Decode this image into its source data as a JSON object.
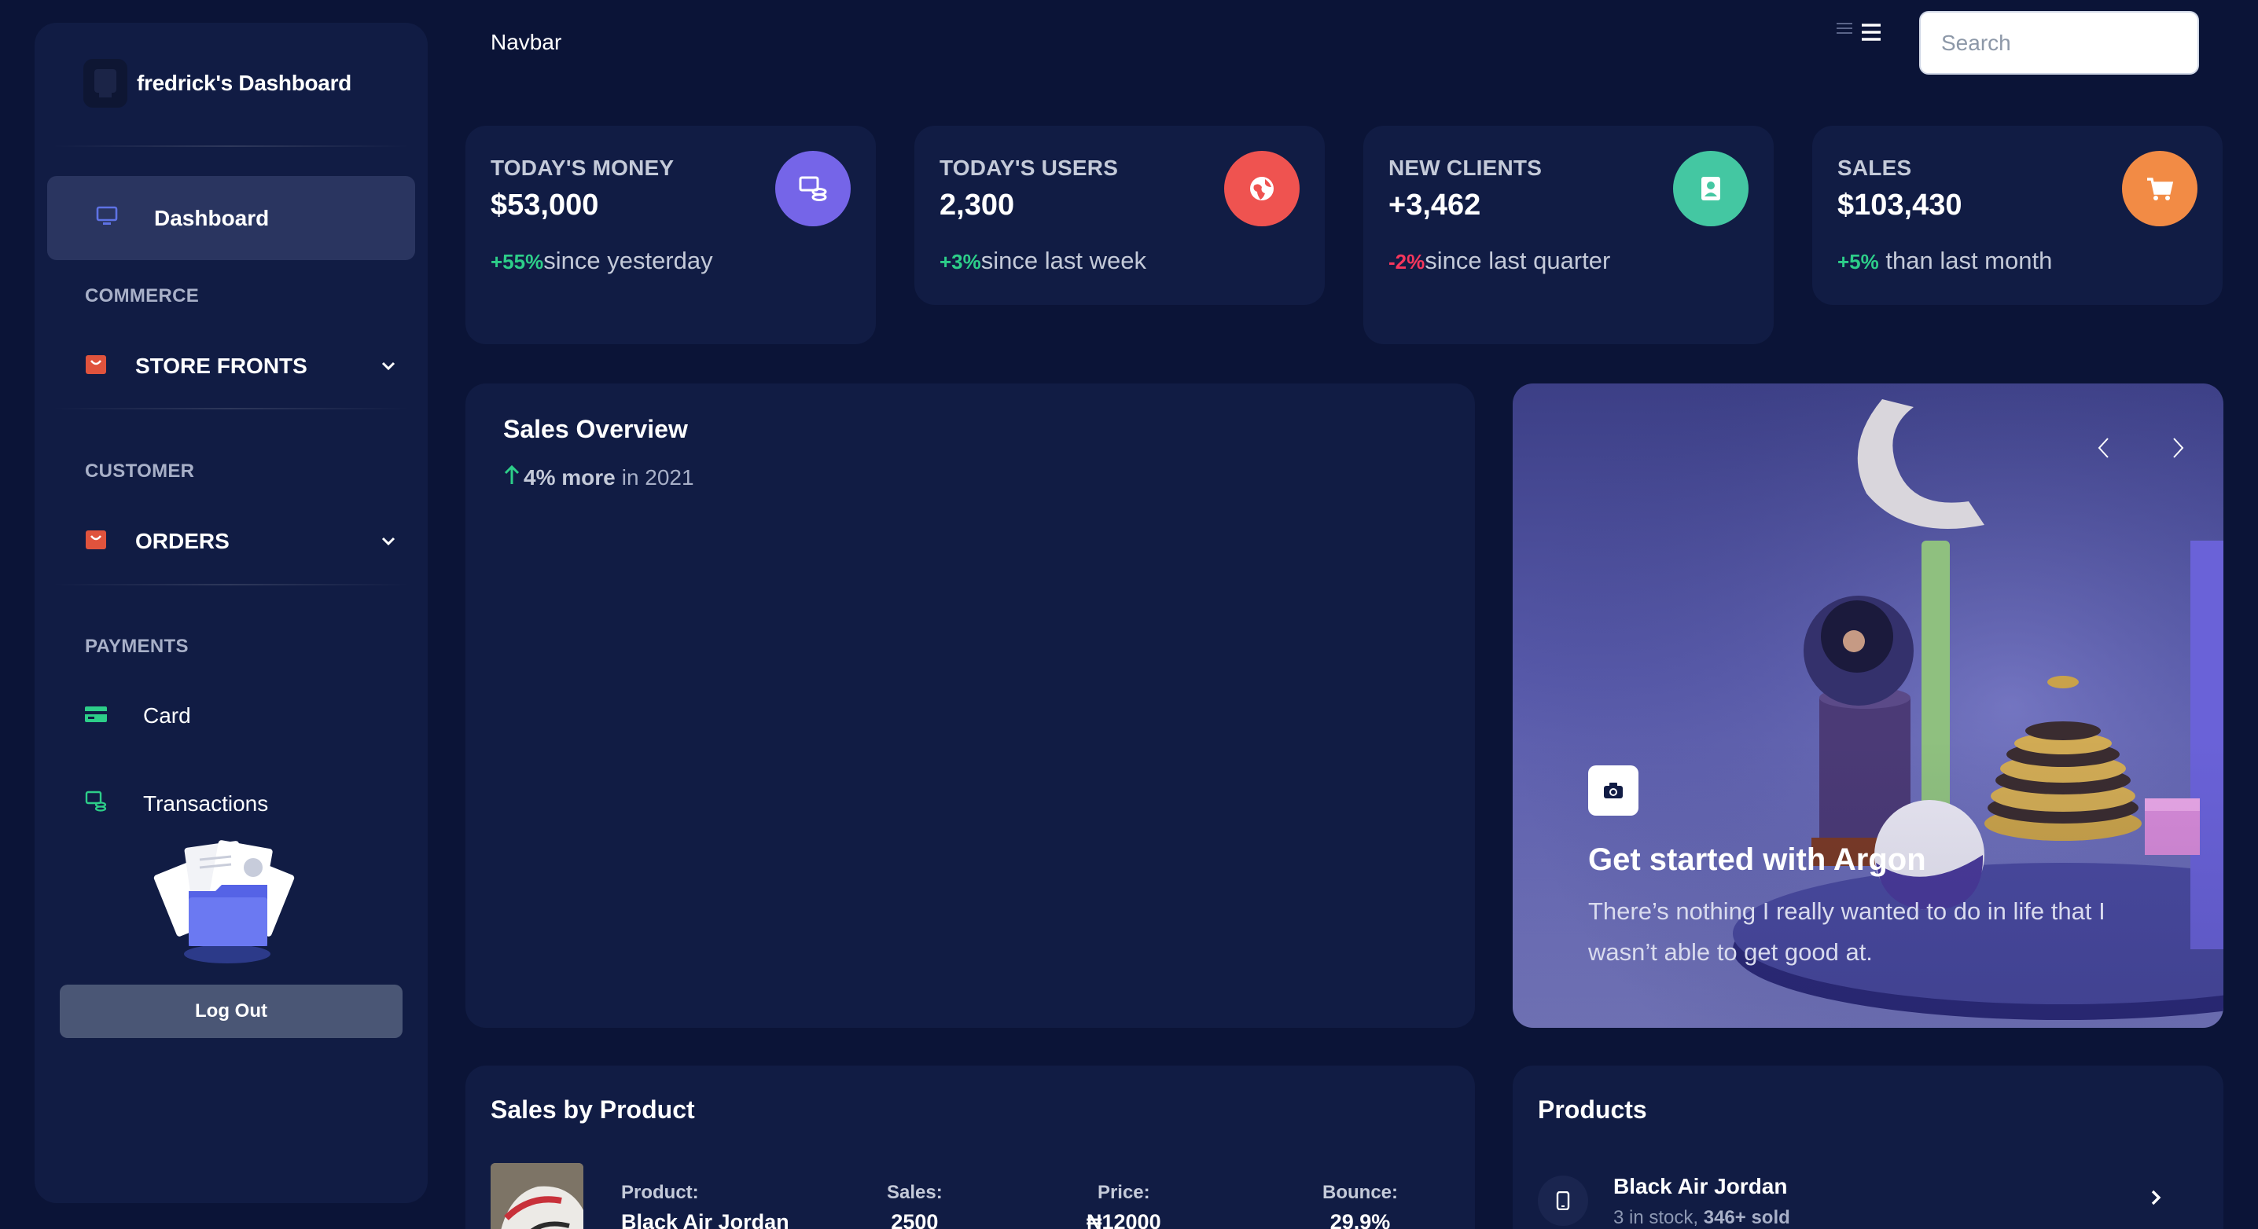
{
  "sidebar": {
    "brand": "fredrick's Dashboard",
    "active_item": "Dashboard",
    "sections": {
      "commerce": "COMMERCE",
      "customer": "CUSTOMER",
      "payments": "PAYMENTS"
    },
    "groups": {
      "store_fronts": "STORE FRONTS",
      "orders": "ORDERS"
    },
    "payments_items": {
      "card": "Card",
      "transactions": "Transactions"
    },
    "logout_label": "Log Out"
  },
  "navbar": {
    "title": "Navbar",
    "search_placeholder": "Search"
  },
  "stats": [
    {
      "title": "TODAY'S MONEY",
      "value": "$53,000",
      "change": "+55%",
      "suffix": "since yesterday",
      "icon": "money-coins-icon",
      "color": "#7565e8"
    },
    {
      "title": "TODAY'S USERS",
      "value": "2,300",
      "change": "+3%",
      "suffix": "since last week",
      "icon": "world-icon",
      "color": "#ef5350"
    },
    {
      "title": "NEW CLIENTS",
      "value": "+3,462",
      "change": "-2%",
      "suffix": "since last quarter",
      "icon": "user-card-icon",
      "color": "#44c7a2"
    },
    {
      "title": "SALES",
      "value": "$103,430",
      "change": "+5%",
      "suffix": " than last month",
      "icon": "cart-icon",
      "color": "#f28b45"
    }
  ],
  "overview": {
    "title": "Sales Overview",
    "change": "4% more",
    "period": "in 2021"
  },
  "carousel": {
    "title": "Get started with Argon",
    "text": "There’s nothing I really wanted to do in life that I wasn’t able to get good at."
  },
  "sales_by_product": {
    "title": "Sales by Product",
    "row": {
      "product_label": "Product:",
      "product": "Black Air Jordan",
      "sales_label": "Sales:",
      "sales": "2500",
      "price_label": "Price:",
      "price": "₦12000",
      "bounce_label": "Bounce:",
      "bounce": "29.9%"
    }
  },
  "products": {
    "title": "Products",
    "item": {
      "name": "Black Air Jordan",
      "stock": "3 in stock, ",
      "sold": "346+ sold"
    }
  },
  "colors": {
    "background": "#0b1437",
    "card": "#111c44",
    "positive": "#2dce89",
    "negative": "#f5365c"
  }
}
